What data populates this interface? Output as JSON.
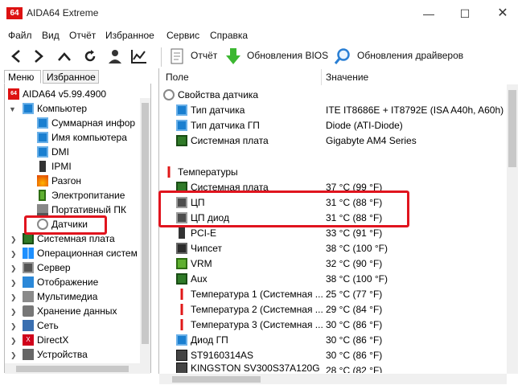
{
  "window": {
    "title": "AIDA64 Extreme",
    "logo": "64"
  },
  "menu": [
    "Файл",
    "Вид",
    "Отчёт",
    "Избранное",
    "Сервис",
    "Справка"
  ],
  "toolbar": {
    "report": "Отчёт",
    "bios_updates": "Обновления BIOS",
    "driver_updates": "Обновления драйверов"
  },
  "tabs": {
    "menu": "Меню",
    "favorites": "Избранное"
  },
  "tree": {
    "root": "AIDA64 v5.99.4900",
    "computer": "Компьютер",
    "children": [
      "Суммарная инфор",
      "Имя компьютера",
      "DMI",
      "IPMI",
      "Разгон",
      "Электропитание",
      "Портативный ПК",
      "Датчики"
    ],
    "top": [
      "Системная плата",
      "Операционная систем",
      "Сервер",
      "Отображение",
      "Мультимедиа",
      "Хранение данных",
      "Сеть",
      "DirectX",
      "Устройства",
      "П"
    ]
  },
  "columns": {
    "field": "Поле",
    "value": "Значение"
  },
  "sections": {
    "sensor_props": "Свойства датчика",
    "temperatures": "Температуры"
  },
  "sensor_props": [
    {
      "field": "Тип датчика",
      "value": "ITE IT8686E + IT8792E  (ISA A40h, A60h)"
    },
    {
      "field": "Тип датчика ГП",
      "value": "Diode  (ATI-Diode)"
    },
    {
      "field": "Системная плата",
      "value": "Gigabyte AM4 Series"
    }
  ],
  "temperatures": [
    {
      "field": "Системная плата",
      "value": "37 °C  (99 °F)"
    },
    {
      "field": "ЦП",
      "value": "31 °C  (88 °F)"
    },
    {
      "field": "ЦП диод",
      "value": "31 °C  (88 °F)"
    },
    {
      "field": "PCI-E",
      "value": "33 °C  (91 °F)"
    },
    {
      "field": "Чипсет",
      "value": "38 °C  (100 °F)"
    },
    {
      "field": "VRM",
      "value": "32 °C  (90 °F)"
    },
    {
      "field": "Aux",
      "value": "38 °C  (100 °F)"
    },
    {
      "field": "Температура 1 (Системная ...",
      "value": "25 °C  (77 °F)"
    },
    {
      "field": "Температура 2 (Системная ...",
      "value": "29 °C  (84 °F)"
    },
    {
      "field": "Температура 3 (Системная ...",
      "value": "30 °C  (86 °F)"
    },
    {
      "field": "Диод ГП",
      "value": "30 °C  (86 °F)"
    },
    {
      "field": "ST9160314AS",
      "value": "30 °C  (86 °F)"
    },
    {
      "field": "KINGSTON SV300S37A120G",
      "value": "28 °C  (82 °F)"
    }
  ]
}
